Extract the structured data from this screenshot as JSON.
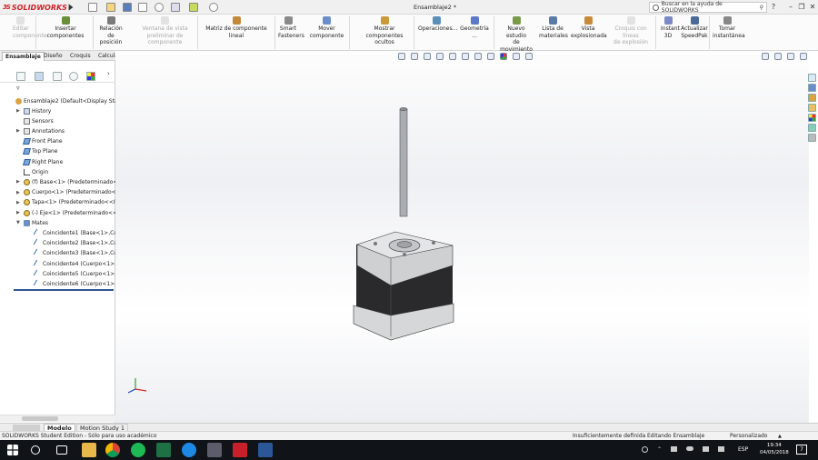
{
  "app": {
    "brand": "SOLIDWORKS",
    "doc_title": "Ensamblaje2 *"
  },
  "search": {
    "placeholder": "Buscar en la ayuda de SOLIDWORKS"
  },
  "ribbon": [
    {
      "label": "Editar\ncomponente",
      "disabled": true
    },
    {
      "label": "Insertar componentes",
      "disabled": false
    },
    {
      "label": "Relación de\nposición",
      "disabled": false
    },
    {
      "label": "Ventana de vista\npreliminar de componente",
      "disabled": true
    },
    {
      "label": "Matriz de componente lineal",
      "disabled": false
    },
    {
      "label": "Smart\nFasteners",
      "disabled": false
    },
    {
      "label": "Mover componente",
      "disabled": false
    },
    {
      "label": "Mostrar\ncomponentes ocultos",
      "disabled": false
    },
    {
      "label": "Operaciones...",
      "disabled": false
    },
    {
      "label": "Geometría ...",
      "disabled": false
    },
    {
      "label": "Nuevo estudio\nde movimiento",
      "disabled": false
    },
    {
      "label": "Lista de\nmateriales",
      "disabled": false
    },
    {
      "label": "Vista\nexplosionada",
      "disabled": false
    },
    {
      "label": "Croquis con líneas\nde explosión",
      "disabled": true
    },
    {
      "label": "Instant\n3D",
      "disabled": false
    },
    {
      "label": "Actualizar\nSpeedPak",
      "disabled": false
    },
    {
      "label": "Tomar\ninstantánea",
      "disabled": false
    }
  ],
  "cm_tabs": [
    "Ensamblaje",
    "Diseño",
    "Croquis",
    "Calcular"
  ],
  "tree": {
    "root": "Ensamblaje2  (Default<Display Sta",
    "items": [
      {
        "label": "History",
        "icon": "history-icon"
      },
      {
        "label": "Sensors",
        "icon": "sensors-icon"
      },
      {
        "label": "Annotations",
        "icon": "annotations-icon"
      },
      {
        "label": "Front Plane",
        "icon": "plane-icon"
      },
      {
        "label": "Top Plane",
        "icon": "plane-icon"
      },
      {
        "label": "Right Plane",
        "icon": "plane-icon"
      },
      {
        "label": "Origin",
        "icon": "origin-icon"
      },
      {
        "label": "(f) Base<1> (Predeterminado<",
        "icon": "part-icon"
      },
      {
        "label": "Cuerpo<1> (Predeterminado<",
        "icon": "part-icon"
      },
      {
        "label": "Tapa<1> (Predeterminado<<I",
        "icon": "part-icon"
      },
      {
        "label": "(-) Eje<1> (Predeterminado<<",
        "icon": "part-icon"
      },
      {
        "label": "Mates",
        "icon": "mates-icon"
      },
      {
        "label": "Coincidente1 (Base<1>,Cu",
        "icon": "mate-icon"
      },
      {
        "label": "Coincidente2 (Base<1>,Cu",
        "icon": "mate-icon"
      },
      {
        "label": "Coincidente3 (Base<1>,Cu",
        "icon": "mate-icon"
      },
      {
        "label": "Coincidente4 (Cuerpo<1>,",
        "icon": "mate-icon"
      },
      {
        "label": "Coincidente5 (Cuerpo<1>,",
        "icon": "mate-icon"
      },
      {
        "label": "Coincidente6 (Cuerpo<1>,",
        "icon": "mate-icon"
      }
    ]
  },
  "bottom_tabs": [
    "Modelo",
    "Motion Study 1"
  ],
  "status": {
    "left": "SOLIDWORKS Student Edition - Sólo para uso académico",
    "mid": "Insuficientemente definida",
    "mode": "Editando Ensamblaje",
    "custom": "Personalizado"
  },
  "taskbar": {
    "lang": "ESP",
    "time": "19:34",
    "date": "04/05/2018",
    "notif": "7"
  },
  "colors": {
    "brand_red": "#d2232a",
    "taskbar": "#101418",
    "accent": "#2b5797"
  }
}
